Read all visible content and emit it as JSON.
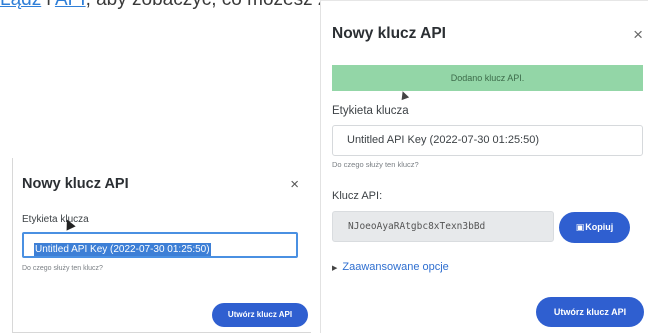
{
  "intro": {
    "link1": "Lądź",
    "separator": " i ",
    "link2": "API",
    "rest": ", aby zobaczyć, co możesz zrobić."
  },
  "left_dialog": {
    "title": "Nowy klucz API",
    "close": "×",
    "label": "Etykieta klucza",
    "input_value": "Untitled API Key (2022-07-30 01:25:50)",
    "help": "Do czego służy ten klucz?",
    "submit": "Utwórz klucz API"
  },
  "right_dialog": {
    "title": "Nowy klucz API",
    "close": "×",
    "success": "Dodano klucz API.",
    "label": "Etykieta klucza",
    "input_value": "Untitled API Key (2022-07-30 01:25:50)",
    "help": "Do czego służy ten klucz?",
    "key_label": "Klucz API:",
    "key_value": "NJoeoAyaRAtgbc8xTexn3bBd",
    "copy_icon": "copy-icon",
    "copy": "Kopiuj",
    "advanced_icon": "caret-right-icon",
    "advanced": "Zaawansowane opcje",
    "submit": "Utwórz klucz API"
  },
  "colors": {
    "primary": "#2f5fd0",
    "success_bg": "#93d6a7",
    "link": "#2f6fd0"
  }
}
